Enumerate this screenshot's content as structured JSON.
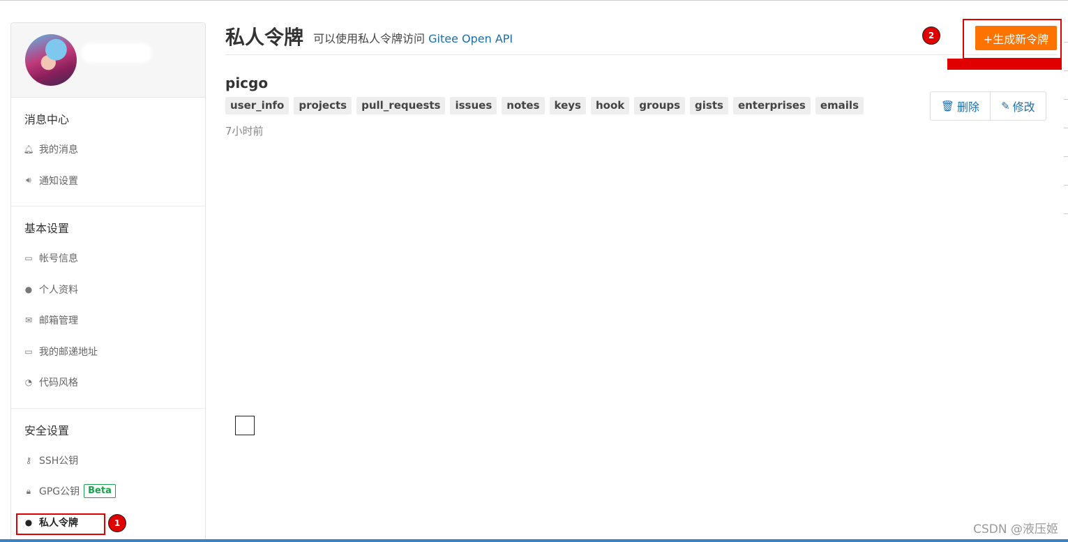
{
  "sidebar": {
    "sections": [
      {
        "title": "消息中心",
        "items": [
          {
            "label": "我的消息",
            "icon": "bell-icon"
          },
          {
            "label": "通知设置",
            "icon": "speaker-icon"
          }
        ]
      },
      {
        "title": "基本设置",
        "items": [
          {
            "label": "帐号信息",
            "icon": "id-card-icon"
          },
          {
            "label": "个人资料",
            "icon": "user-icon"
          },
          {
            "label": "邮箱管理",
            "icon": "envelope-icon"
          },
          {
            "label": "我的邮递地址",
            "icon": "address-card-icon"
          },
          {
            "label": "代码风格",
            "icon": "gauge-icon"
          }
        ]
      },
      {
        "title": "安全设置",
        "items": [
          {
            "label": "SSH公钥",
            "icon": "key-icon"
          },
          {
            "label": "GPG公钥",
            "icon": "lock-icon",
            "badge": "Beta"
          },
          {
            "label": "私人令牌",
            "icon": "user-secret-icon",
            "active": true
          }
        ]
      }
    ]
  },
  "annotations": {
    "step1": "1",
    "step2": "2"
  },
  "header": {
    "title": "私人令牌",
    "subtitle_prefix": "可以使用私人令牌访问",
    "subtitle_link": "Gitee Open API",
    "generate_button": "+生成新令牌"
  },
  "token": {
    "name": "picgo",
    "scopes": [
      "user_info",
      "projects",
      "pull_requests",
      "issues",
      "notes",
      "keys",
      "hook",
      "groups",
      "gists",
      "enterprises",
      "emails"
    ],
    "time": "7小时前",
    "delete_label": "删除",
    "edit_label": "修改"
  },
  "watermark": "CSDN @液压姬",
  "colors": {
    "accent": "#fe7300",
    "link": "#1b6ea8",
    "annotation": "#e00000",
    "beta": "#16a34a"
  }
}
